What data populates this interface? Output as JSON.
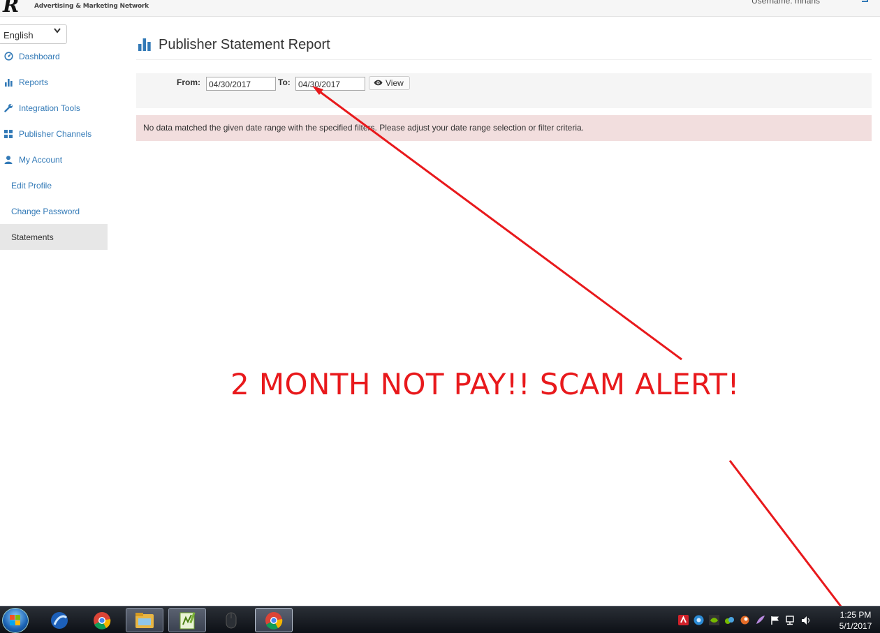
{
  "header": {
    "logo_mark": "R",
    "logo_text": "Advertising & Marketing Network",
    "username": "Username: mharis"
  },
  "sidebar": {
    "language": "English",
    "items": [
      {
        "label": "Dashboard",
        "icon": "dashboard-icon"
      },
      {
        "label": "Reports",
        "icon": "bar-chart-icon"
      },
      {
        "label": "Integration Tools",
        "icon": "wrench-icon"
      },
      {
        "label": "Publisher Channels",
        "icon": "grid-icon"
      },
      {
        "label": "My Account",
        "icon": "user-icon"
      },
      {
        "label": "Edit Profile"
      },
      {
        "label": "Change Password"
      },
      {
        "label": "Statements",
        "active": true
      }
    ]
  },
  "main": {
    "title": "Publisher Statement Report",
    "filter": {
      "from_label": "From:",
      "from_value": "04/30/2017",
      "to_label": "To:",
      "to_value": "04/30/2017",
      "view_label": "View"
    },
    "alert": "No data matched the given date range with the specified filters.  Please adjust your date range selection or filter criteria."
  },
  "annotation": {
    "text": "2 MONTH NOT PAY!! SCAM ALERT!",
    "color": "#e8191c"
  },
  "taskbar": {
    "apps": [
      "windows-start-orb",
      "app-icon-blue-globe",
      "chrome-icon",
      "file-explorer-icon",
      "notepad-plus-icon",
      "mouse-icon",
      "chrome-icon-active"
    ],
    "time": "1:25 PM",
    "date": "5/1/2017"
  },
  "colors": {
    "link": "#337ab7",
    "alert_bg": "#f2dede",
    "active_bg": "#e7e7e7"
  }
}
